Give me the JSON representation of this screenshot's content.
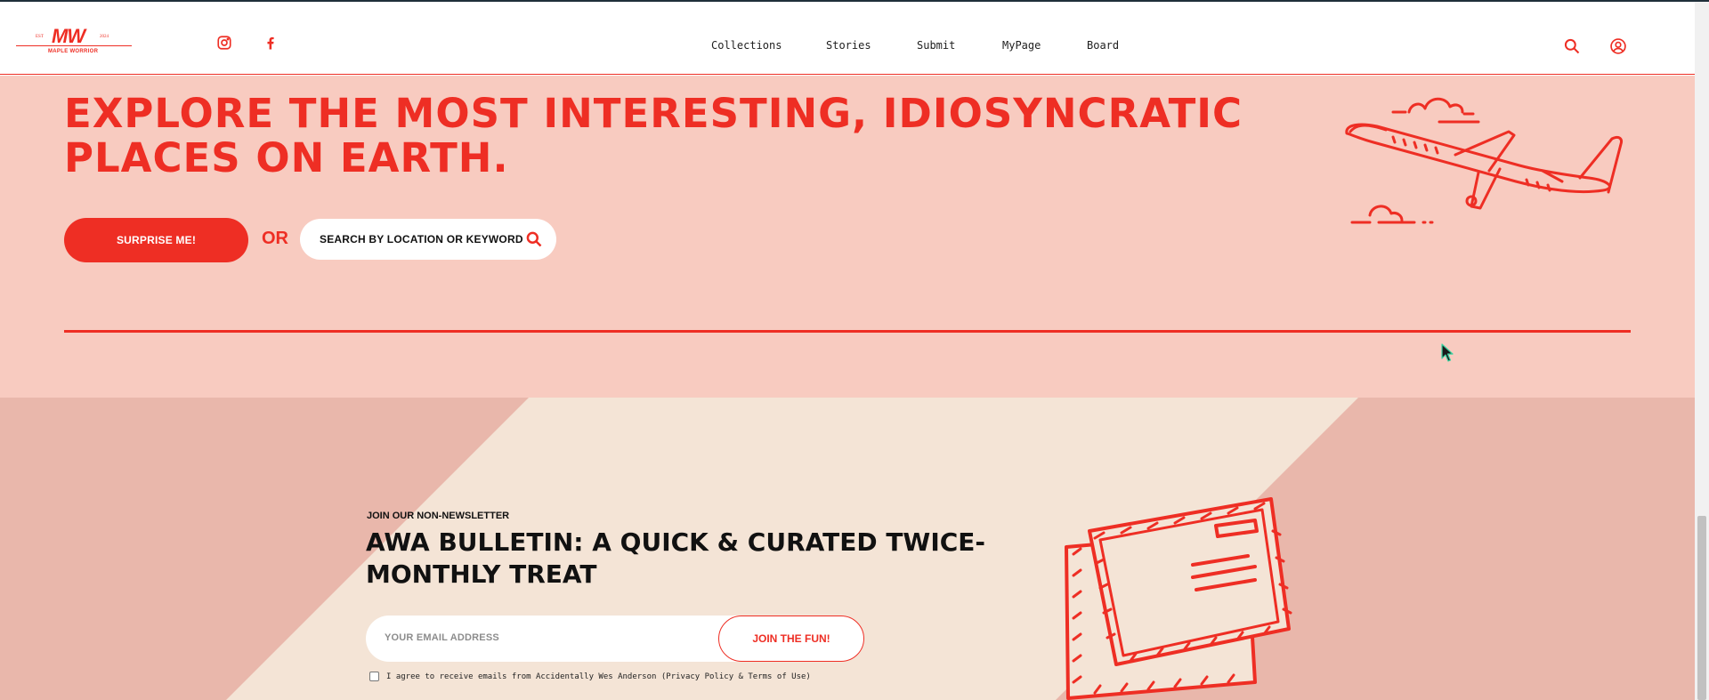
{
  "brand": {
    "logo_mark": "MW",
    "logo_est": "EST",
    "logo_year": "2024",
    "logo_name": "MAPLE WORRIOR",
    "accent_color": "#ee2e24",
    "hero_bg": "#f8cbc0"
  },
  "social": [
    {
      "name": "instagram-icon"
    },
    {
      "name": "facebook-icon"
    }
  ],
  "nav": {
    "items": [
      {
        "label": "Collections"
      },
      {
        "label": "Stories"
      },
      {
        "label": "Submit"
      },
      {
        "label": "MyPage"
      },
      {
        "label": "Board"
      }
    ]
  },
  "header_icons": {
    "search": "search-icon",
    "account": "user-icon"
  },
  "hero": {
    "headline_line1": "EXPLORE THE MOST INTERESTING, IDIOSYNCRATIC",
    "headline_line2": "PLACES ON EARTH.",
    "surprise_label": "SURPRISE ME!",
    "or_label": "OR",
    "search_placeholder": "SEARCH BY LOCATION OR KEYWORD"
  },
  "newsletter": {
    "kicker": "JOIN OUR NON-NEWSLETTER",
    "title_line1": "AWA BULLETIN: A QUICK & CURATED TWICE-",
    "title_line2": "MONTHLY TREAT",
    "email_placeholder": "YOUR EMAIL ADDRESS",
    "join_label": "JOIN THE FUN!",
    "consent_text": "I agree to receive emails from Accidentally Wes Anderson (Privacy Policy & Terms of Use)"
  }
}
